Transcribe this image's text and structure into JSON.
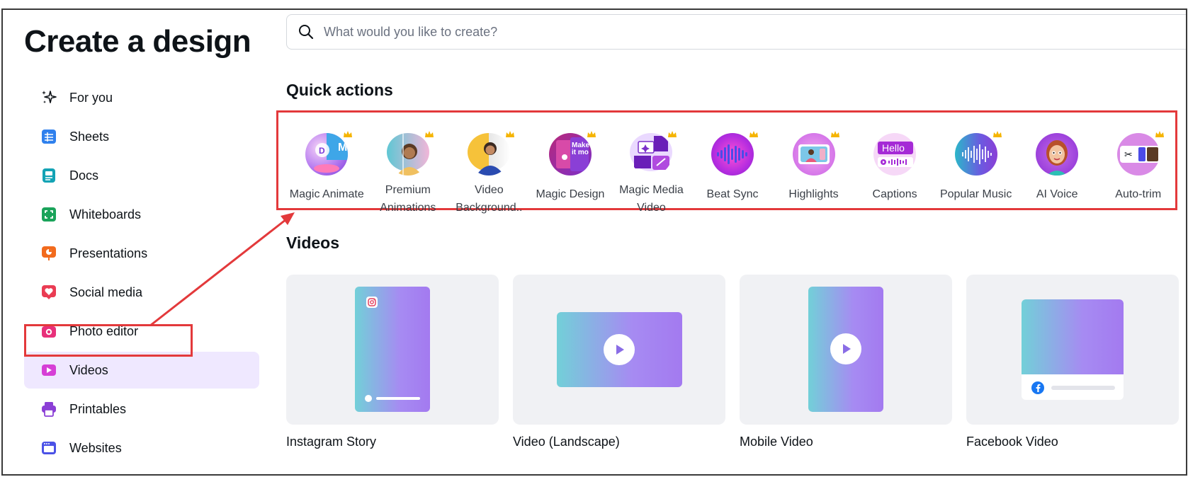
{
  "page": {
    "title": "Create a design"
  },
  "search": {
    "placeholder": "What would you like to create?"
  },
  "sidebar": {
    "items": [
      {
        "label": "For you",
        "icon": "sparkle-icon",
        "color": "#0e1318"
      },
      {
        "label": "Sheets",
        "icon": "sheets-icon",
        "color": "#2f80ed"
      },
      {
        "label": "Docs",
        "icon": "docs-icon",
        "color": "#13a3b5"
      },
      {
        "label": "Whiteboards",
        "icon": "whiteboard-icon",
        "color": "#1aa35a"
      },
      {
        "label": "Presentations",
        "icon": "presentation-icon",
        "color": "#f26b1d"
      },
      {
        "label": "Social media",
        "icon": "heart-icon",
        "color": "#ea3c53"
      },
      {
        "label": "Photo editor",
        "icon": "camera-icon",
        "color": "#e8307a"
      },
      {
        "label": "Videos",
        "icon": "video-icon",
        "color": "#d63fd6"
      },
      {
        "label": "Printables",
        "icon": "printer-icon",
        "color": "#8b3fd6"
      },
      {
        "label": "Websites",
        "icon": "browser-icon",
        "color": "#4b52e6"
      }
    ]
  },
  "quick_actions": {
    "title": "Quick actions",
    "items": [
      {
        "label": "Magic Animate",
        "premium": true
      },
      {
        "label": "Premium Animations",
        "premium": true
      },
      {
        "label": "Video Background..",
        "premium": true
      },
      {
        "label": "Magic Design",
        "premium": true
      },
      {
        "label": "Magic Media Video",
        "premium": true
      },
      {
        "label": "Beat Sync",
        "premium": true
      },
      {
        "label": "Highlights",
        "premium": true
      },
      {
        "label": "Captions",
        "premium": false,
        "thumb_text": "Hello"
      },
      {
        "label": "Popular Music",
        "premium": true
      },
      {
        "label": "AI Voice",
        "premium": false
      },
      {
        "label": "Auto-trim",
        "premium": true
      }
    ]
  },
  "videos": {
    "title": "Videos",
    "cards": [
      {
        "label": "Instagram Story"
      },
      {
        "label": "Video (Landscape)"
      },
      {
        "label": "Mobile Video"
      },
      {
        "label": "Facebook Video"
      }
    ]
  },
  "colors": {
    "accent": "#e3393b",
    "active_bg": "#efe8ff",
    "crown": "#f5b400"
  }
}
